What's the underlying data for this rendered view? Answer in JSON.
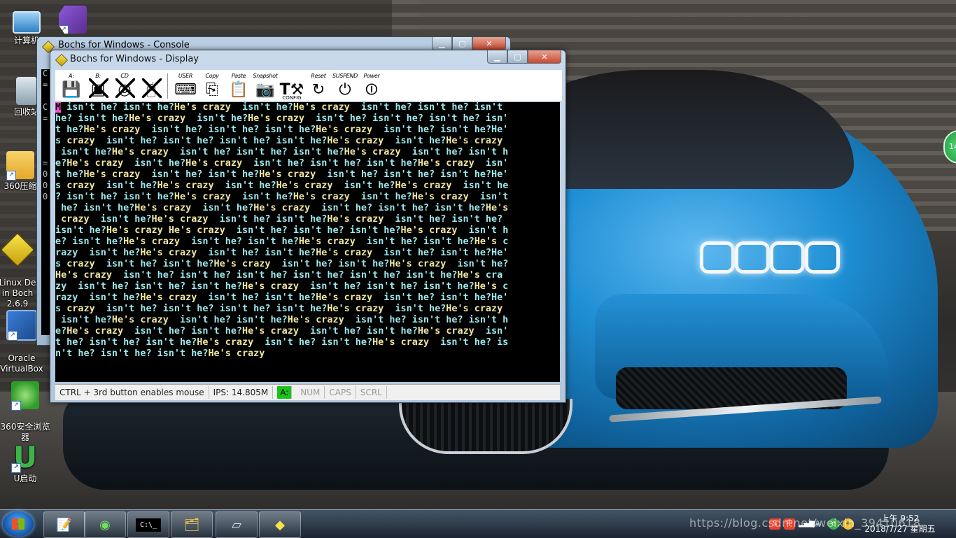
{
  "desktop": {
    "icons": [
      {
        "label": "计算机",
        "icon": "computer-icon"
      },
      {
        "label": "",
        "icon": "visual-studio-icon"
      },
      {
        "label": "回收站",
        "icon": "recycle-bin-icon"
      },
      {
        "label": "360压缩",
        "icon": "folder-icon"
      },
      {
        "label": "Linux De\nin Boch\n2.6.9",
        "icon": "bochs-icon"
      },
      {
        "label": "Oracle\nVirtualBox",
        "icon": "virtualbox-icon"
      },
      {
        "label": "360安全浏览\n器",
        "icon": "360-browser-icon"
      },
      {
        "label": "U启动",
        "icon": "u-start-icon"
      }
    ],
    "badge": "14"
  },
  "console_window": {
    "title": "Bochs for Windows - Console",
    "lines": [
      "C",
      "=",
      "",
      "C",
      "=",
      "",
      "",
      "",
      "=",
      "0",
      "0",
      "0"
    ]
  },
  "display_window": {
    "title": "Bochs for Windows - Display",
    "toolbar": {
      "floppy_a": "A:",
      "floppy_b": "B:",
      "cdrom": "CD",
      "user": "USER",
      "copy": "Copy",
      "paste": "Paste",
      "snapshot": "Snapshot",
      "config": "CONFIG",
      "reset": "Reset",
      "suspend": "SUSPEND",
      "power": "Power"
    },
    "screen_lines": [
      "M isn't he? isn't he?He's crazy  isn't he?He's crazy  isn't he? isn't he? isn't",
      "he? isn't he?He's crazy  isn't he?He's crazy  isn't he? isn't he? isn't he? isn'",
      "t he?He's crazy  isn't he? isn't he? isn't he?He's crazy  isn't he? isn't he?He'",
      "s crazy  isn't he? isn't he? isn't he? isn't he?He's crazy  isn't he?He's crazy",
      " isn't he?He's crazy  isn't he? isn't he? isn't he?He's crazy  isn't he? isn't h",
      "e?He's crazy  isn't he?He's crazy  isn't he? isn't he? isn't he?He's crazy  isn'",
      "t he?He's crazy  isn't he? isn't he?He's crazy  isn't he? isn't he? isn't he?He'",
      "s crazy  isn't he?He's crazy  isn't he?He's crazy  isn't he?He's crazy  isn't he",
      "? isn't he? isn't he?He's crazy  isn't he?He's crazy  isn't he?He's crazy  isn't",
      " he? isn't he?He's crazy  isn't he?He's crazy  isn't he? isn't he? isn't he?He's",
      " crazy  isn't he?He's crazy  isn't he? isn't he?He's crazy  isn't he? isn't he?",
      "isn't he?He's crazy He's crazy  isn't he? isn't he? isn't he?He's crazy  isn't h",
      "e? isn't he?He's crazy  isn't he? isn't he?He's crazy  isn't he? isn't he?He's c",
      "razy  isn't he?He's crazy  isn't he? isn't he?He's crazy  isn't he? isn't he?He'",
      "s crazy  isn't he? isn't he?He's crazy  isn't he? isn't he?He's crazy  isn't he?",
      "He's crazy  isn't he? isn't he? isn't he? isn't he? isn't he? isn't he?He's cra",
      "zy  isn't he? isn't he? isn't he?He's crazy  isn't he? isn't he? isn't he?He's c",
      "razy  isn't he?He's crazy  isn't he? isn't he?He's crazy  isn't he? isn't he?He'",
      "s crazy  isn't he? isn't he? isn't he? isn't he?He's crazy  isn't he?He's crazy",
      " isn't he?He's crazy  isn't he? isn't he?He's crazy  isn't he? isn't he? isn't h",
      "e?He's crazy  isn't he? isn't he?He's crazy  isn't he? isn't he?He's crazy  isn'",
      "t he? isn't he? isn't he?He's crazy  isn't he? isn't he?He's crazy  isn't he? is",
      "n't he? isn't he? isn't he?He's crazy"
    ],
    "statusbar": {
      "mouse_hint": "CTRL + 3rd button enables mouse",
      "ips": "IPS: 14.805M",
      "drive_a": "A:",
      "num": "NUM",
      "caps": "CAPS",
      "scrl": "SCRL"
    }
  },
  "taskbar": {
    "items": [
      "notepad-plus-icon",
      "360-browser-icon",
      "cmd-icon",
      "explorer-icon",
      "editor-icon",
      "bochs-icon"
    ],
    "cmd_label": "C:\\_",
    "clock_time": "上午 9:52",
    "clock_date": "2018/7/27 星期五",
    "watermark": "https://blog.csdn.net/weixin_39410618",
    "tray_ime": "S",
    "tray_lang": "中"
  },
  "colors": {
    "screen_text_yellow": "#f0e7a0",
    "screen_text_cyan": "#9ee7ea",
    "cursor": "#ff4bd1",
    "led_green": "#18c418"
  }
}
